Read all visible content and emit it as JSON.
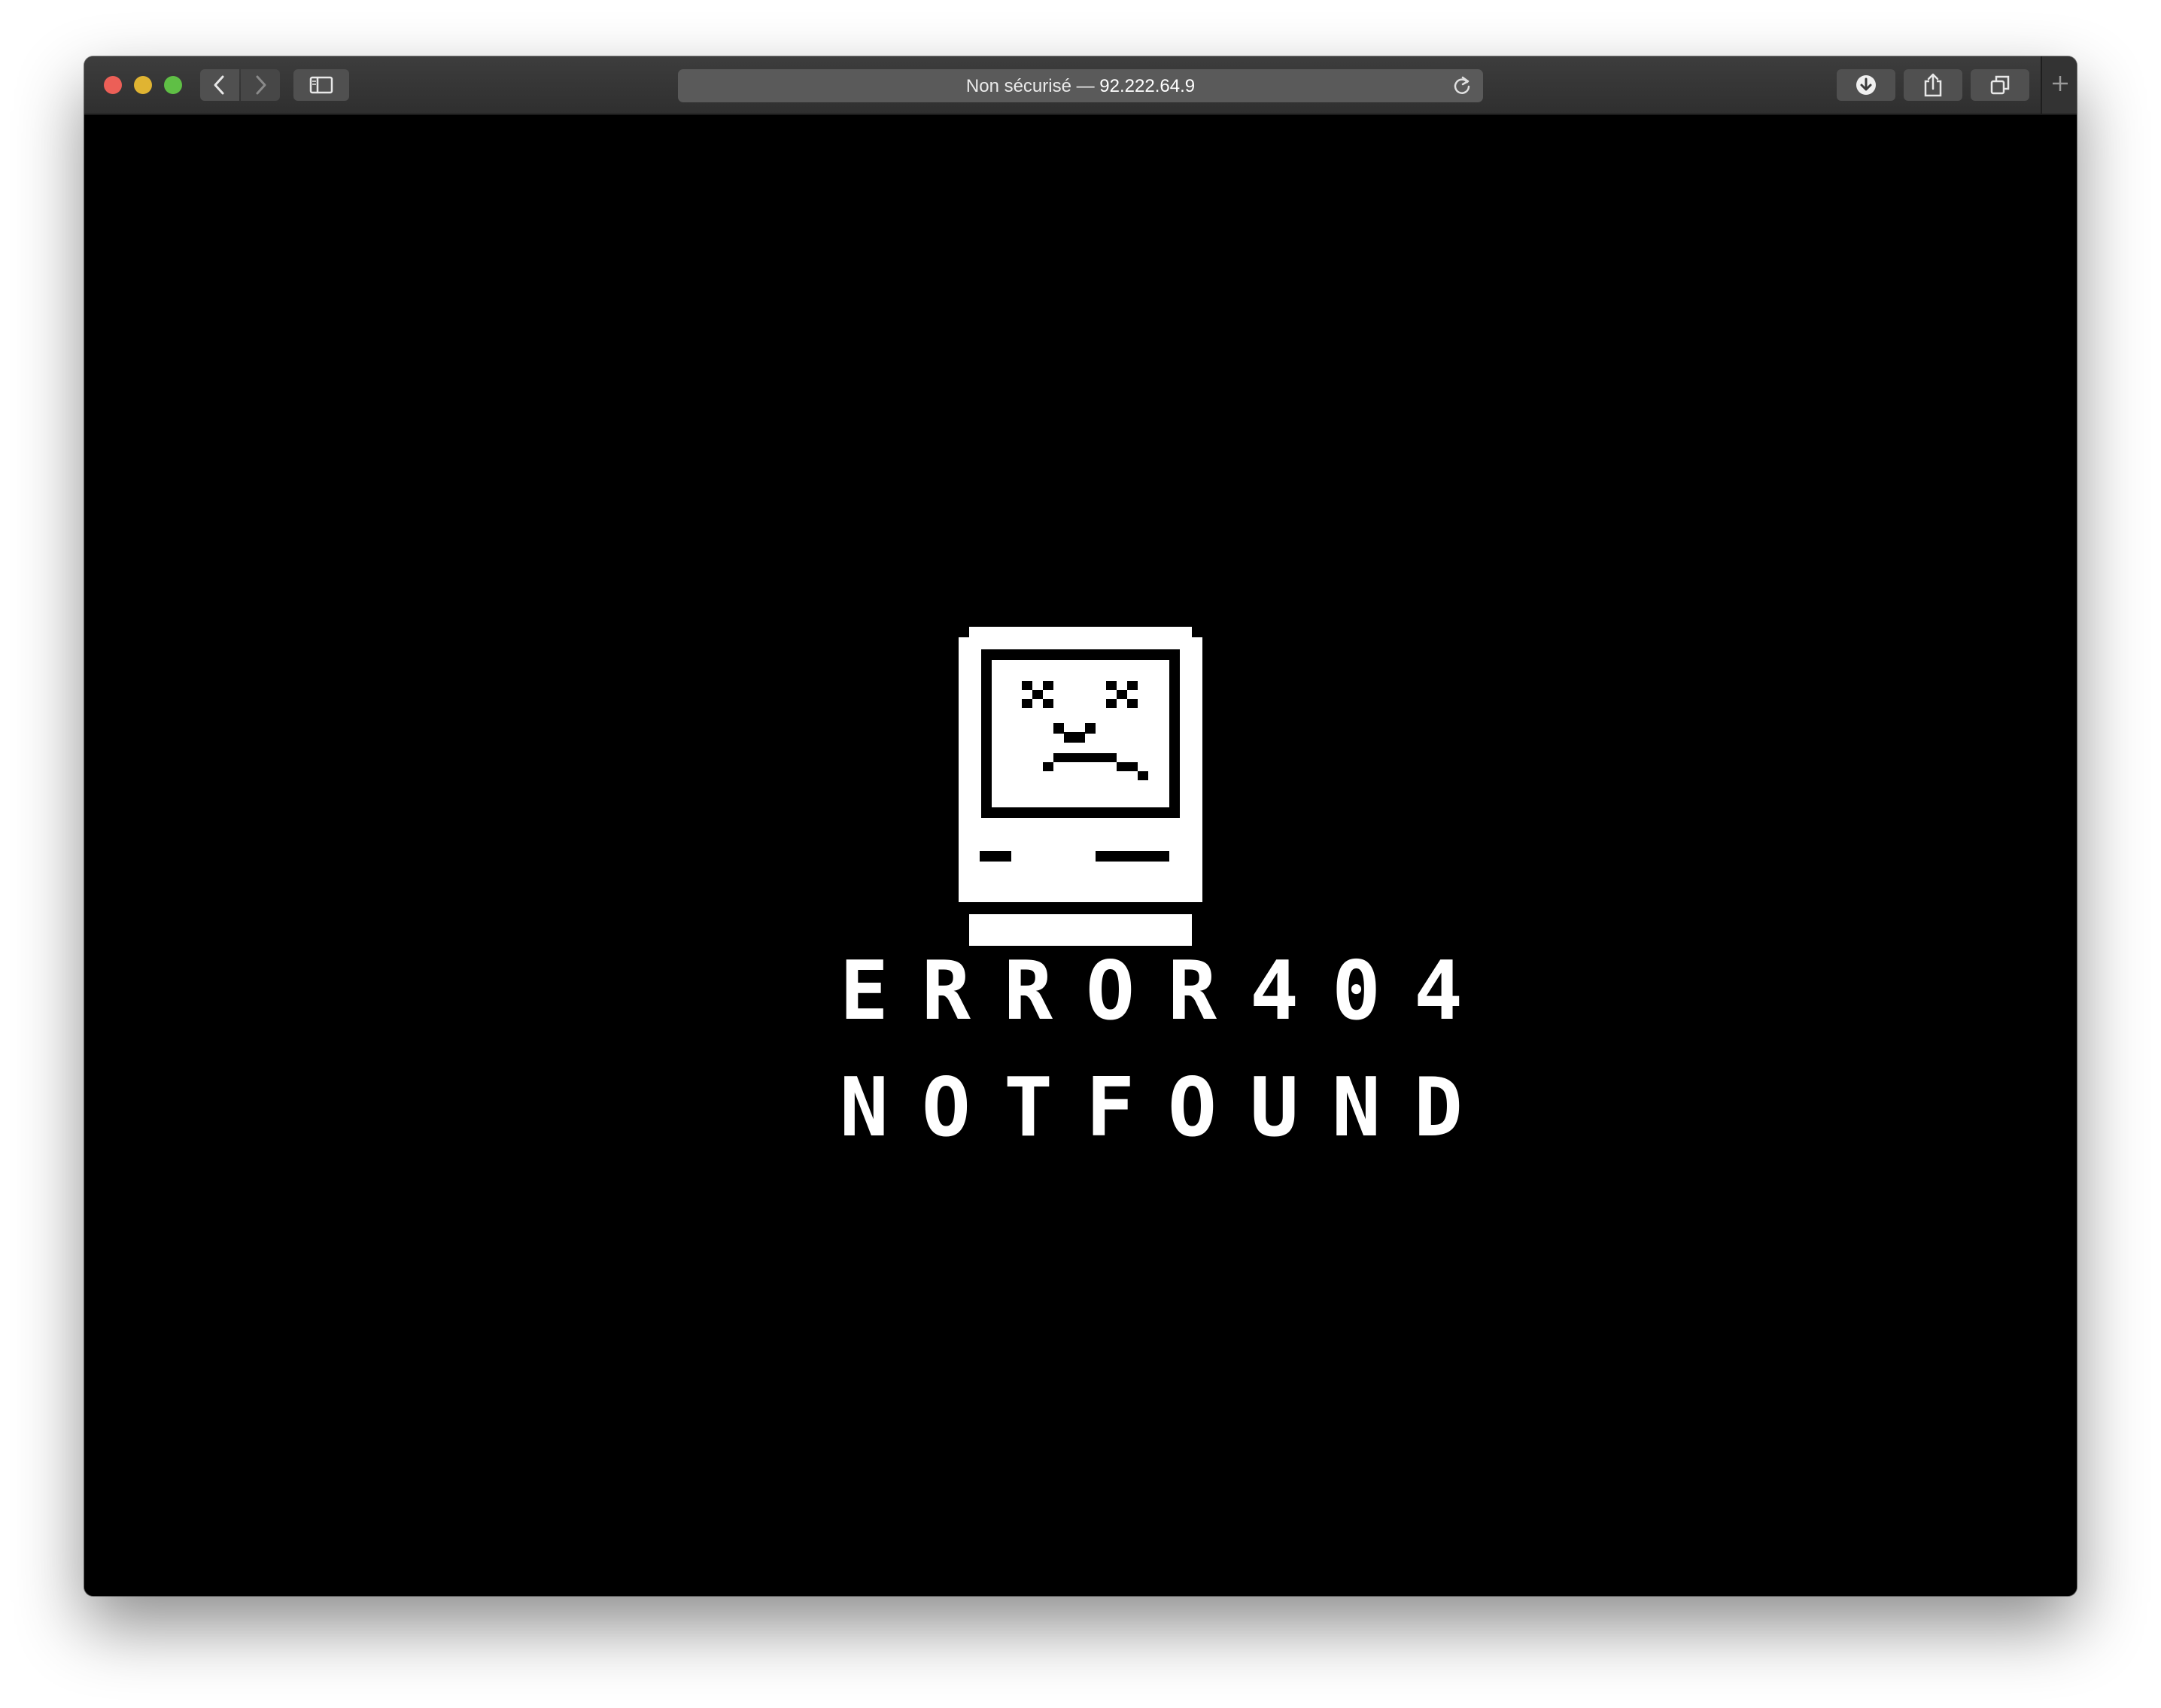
{
  "browser": {
    "address_prefix": "Non sécurisé — ",
    "address_host": "92.222.64.9",
    "icons": {
      "back": "chevron-left-icon",
      "forward": "chevron-right-icon",
      "sidebar": "sidebar-icon",
      "reload": "reload-icon",
      "download": "download-icon",
      "share": "share-icon",
      "tabs": "tabs-overview-icon",
      "new_tab": "plus-icon"
    }
  },
  "page": {
    "line1": "ERROR404",
    "line2": "NOTFOUND",
    "illustration": "sad-mac-icon"
  },
  "colors": {
    "background": "#000000",
    "foreground": "#ffffff",
    "close": "#ec5f57",
    "minimize": "#e0b432",
    "maximize": "#5fbf45"
  }
}
